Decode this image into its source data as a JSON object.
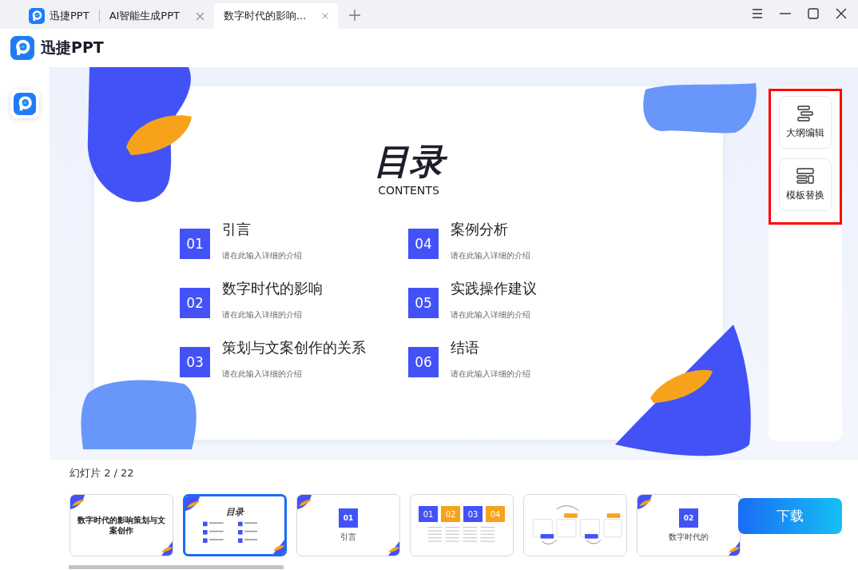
{
  "tabs": [
    {
      "label": "迅捷PPT",
      "kind": "home",
      "selected": false
    },
    {
      "label": "AI智能生成PPT",
      "kind": "doc",
      "selected": false
    },
    {
      "label": "数字时代的影响...",
      "kind": "doc",
      "selected": true
    }
  ],
  "brand": "迅捷PPT",
  "slide": {
    "title": "目录",
    "subtitle": "CONTENTS",
    "items": [
      {
        "number": "01",
        "title": "引言",
        "description": "请在此输入详细的介绍"
      },
      {
        "number": "04",
        "title": "案例分析",
        "description": "请在此输入详细的介绍"
      },
      {
        "number": "02",
        "title": "数字时代的影响",
        "description": "请在此输入详细的介绍"
      },
      {
        "number": "05",
        "title": "实践操作建议",
        "description": "请在此输入详细的介绍"
      },
      {
        "number": "03",
        "title": "策划与文案创作的关系",
        "description": "请在此输入详细的介绍"
      },
      {
        "number": "06",
        "title": "结语",
        "description": "请在此输入详细的介绍"
      }
    ]
  },
  "side_panel": {
    "highlighted": true,
    "buttons": [
      {
        "label": "大纲编辑",
        "kind": "outline"
      },
      {
        "label": "模板替换",
        "kind": "template"
      }
    ]
  },
  "slide_counter": "幻灯片 2 / 22",
  "thumbnails": [
    {
      "kind": "title",
      "title": "数字时代的影响策划与文案创作",
      "selected": false
    },
    {
      "kind": "contents",
      "title": "目录",
      "selected": true
    },
    {
      "kind": "section",
      "number": "01",
      "title": "引言",
      "selected": false
    },
    {
      "kind": "cards",
      "numbers": [
        "01",
        "02",
        "03",
        "04"
      ],
      "selected": false
    },
    {
      "kind": "flow",
      "selected": false
    },
    {
      "kind": "section",
      "number": "02",
      "title": "数字时代的",
      "selected": false
    }
  ],
  "download_button": "下载"
}
